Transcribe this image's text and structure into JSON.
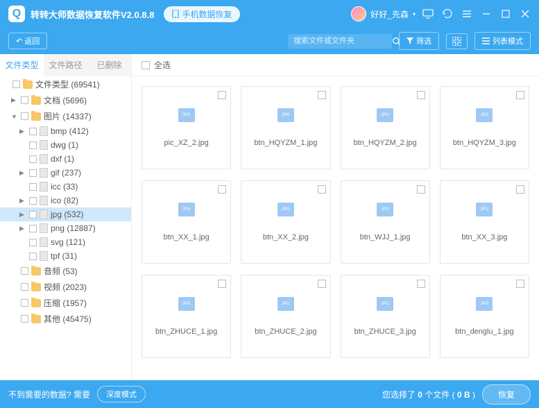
{
  "titlebar": {
    "app_title": "转转大师数据恢复软件V2.0.8.8",
    "mobile_button": "手机数据恢复",
    "username": "好好_先森"
  },
  "toolbar": {
    "back": "返回",
    "search_placeholder": "搜索文件或文件夹",
    "filter": "筛选",
    "list_mode": "列表模式"
  },
  "sidebar": {
    "tabs": [
      "文件类型",
      "文件路径",
      "已删除"
    ],
    "tree": [
      {
        "label": "文件类型 (69541)",
        "type": "folder",
        "indent": 0,
        "arrow": ""
      },
      {
        "label": "文档 (5696)",
        "type": "folder",
        "indent": 1,
        "arrow": "▶"
      },
      {
        "label": "图片 (14337)",
        "type": "folder",
        "indent": 1,
        "arrow": "▼"
      },
      {
        "label": "bmp (412)",
        "type": "file",
        "indent": 2,
        "arrow": "▶"
      },
      {
        "label": "dwg (1)",
        "type": "file",
        "indent": 2,
        "arrow": ""
      },
      {
        "label": "dxf (1)",
        "type": "file",
        "indent": 2,
        "arrow": ""
      },
      {
        "label": "gif (237)",
        "type": "file",
        "indent": 2,
        "arrow": "▶"
      },
      {
        "label": "icc (33)",
        "type": "file",
        "indent": 2,
        "arrow": ""
      },
      {
        "label": "ico (82)",
        "type": "file",
        "indent": 2,
        "arrow": "▶"
      },
      {
        "label": "jpg (532)",
        "type": "file",
        "indent": 2,
        "arrow": "▶",
        "selected": true
      },
      {
        "label": "png (12887)",
        "type": "file",
        "indent": 2,
        "arrow": "▶"
      },
      {
        "label": "svg (121)",
        "type": "file",
        "indent": 2,
        "arrow": ""
      },
      {
        "label": "tpf (31)",
        "type": "file",
        "indent": 2,
        "arrow": ""
      },
      {
        "label": "音频 (53)",
        "type": "folder",
        "indent": 1,
        "arrow": ""
      },
      {
        "label": "视频 (2023)",
        "type": "folder",
        "indent": 1,
        "arrow": ""
      },
      {
        "label": "压缩 (1957)",
        "type": "folder",
        "indent": 1,
        "arrow": ""
      },
      {
        "label": "其他 (45475)",
        "type": "folder",
        "indent": 1,
        "arrow": ""
      }
    ]
  },
  "content": {
    "select_all": "全选",
    "files": [
      "pic_XZ_2.jpg",
      "btn_HQYZM_1.jpg",
      "btn_HQYZM_2.jpg",
      "btn_HQYZM_3.jpg",
      "btn_XX_1.jpg",
      "btn_XX_2.jpg",
      "btn_WJJ_1.jpg",
      "btn_XX_3.jpg",
      "btn_ZHUCE_1.jpg",
      "btn_ZHUCE_2.jpg",
      "btn_ZHUCE_3.jpg",
      "btn_denglu_1.jpg"
    ]
  },
  "footer": {
    "hint_prefix": "不到需要的数据? 需要",
    "deep_mode": "深度模式",
    "selected_prefix": "您选择了 ",
    "selected_count": "0",
    "selected_mid": " 个文件 ( ",
    "selected_size": "0 B",
    "selected_suffix": " )",
    "recover": "恢复"
  }
}
